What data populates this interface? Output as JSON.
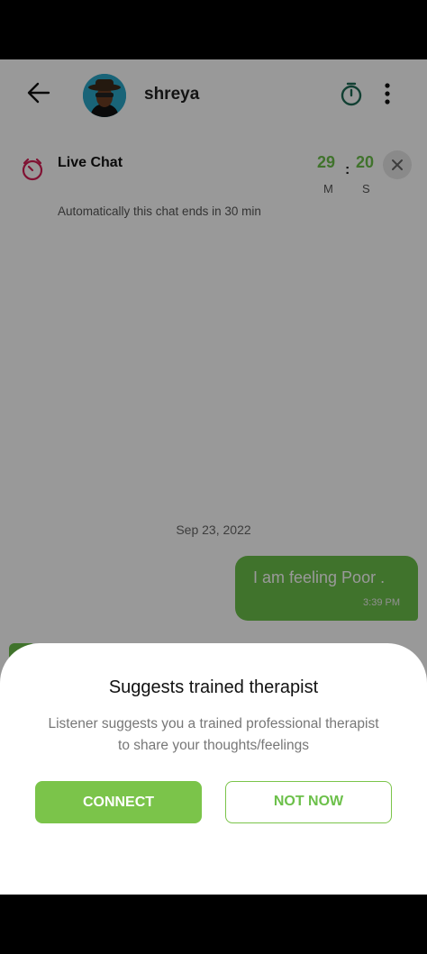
{
  "header": {
    "username": "shreya",
    "icons": [
      "arrow-left-icon",
      "stopwatch-icon",
      "more-vertical-icon"
    ]
  },
  "live_chat": {
    "title": "Live Chat",
    "subtitle": "Automatically this chat ends in 30 min",
    "timer_minutes": "29",
    "timer_seconds": "20",
    "separator": ":",
    "minutes_label": "M",
    "seconds_label": "S"
  },
  "chat": {
    "date": "Sep 23, 2022",
    "messages": [
      {
        "text": "I am feeling Poor .",
        "time": "3:39 PM",
        "outgoing": true
      }
    ]
  },
  "sheet": {
    "title": "Suggests trained therapist",
    "body": "Listener suggests you a trained professional therapist to share your thoughts/feelings",
    "connect_label": "CONNECT",
    "not_now_label": "NOT NOW"
  },
  "colors": {
    "accent_green": "#6cc04a",
    "live_icon": "#d61f55",
    "timer_icon": "#1e6b55"
  }
}
